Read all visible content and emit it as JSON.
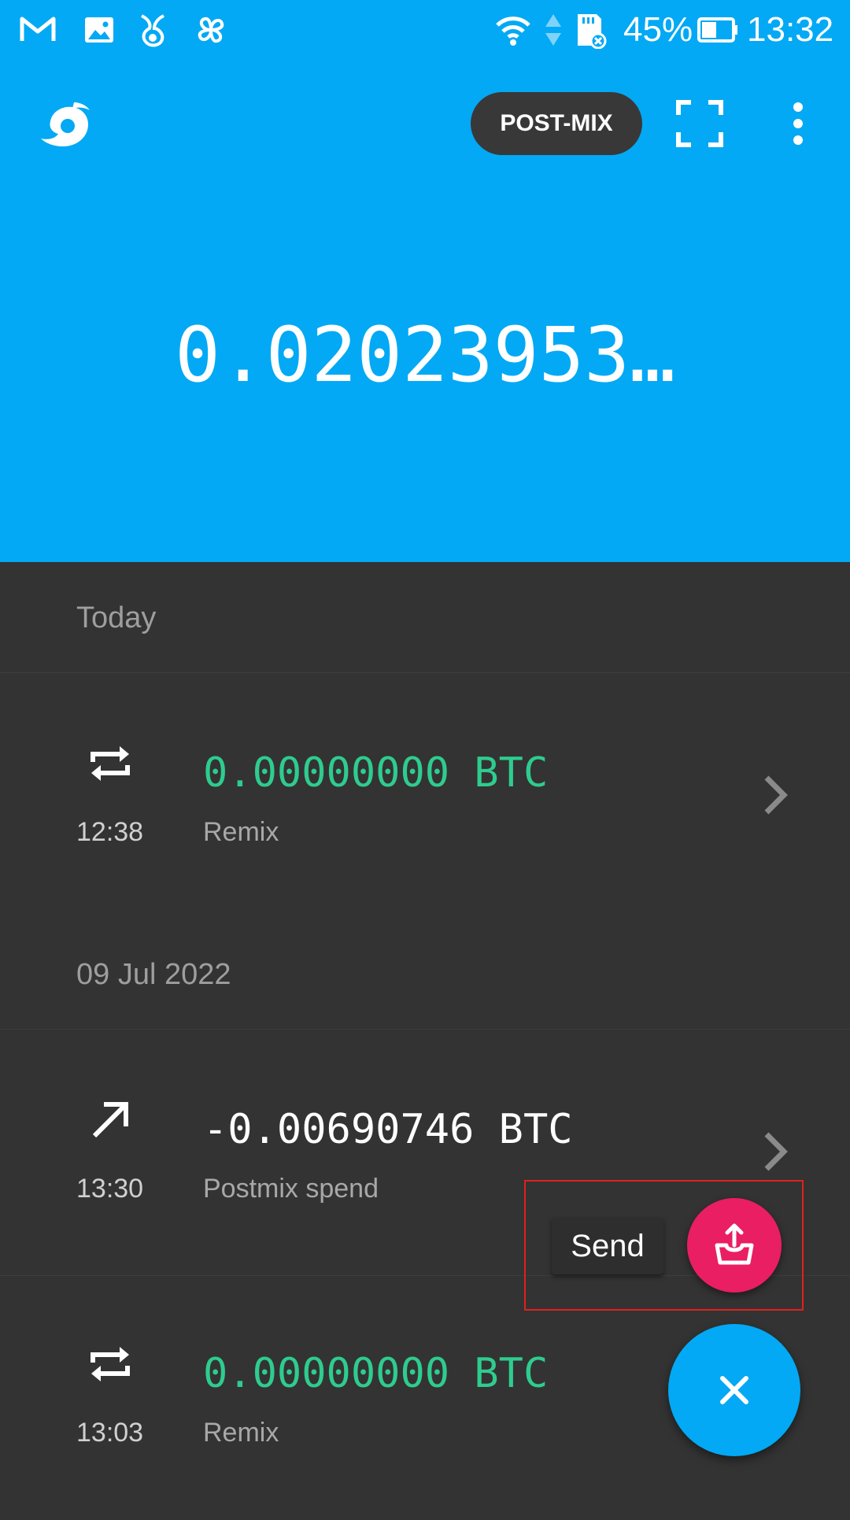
{
  "status_bar": {
    "battery_percent": "45%",
    "time": "13:32",
    "icons": [
      "gmail-icon",
      "gallery-icon",
      "tor-onion-icon",
      "fan-icon",
      "wifi-icon",
      "data-arrows-icon",
      "sd-card-error-icon",
      "battery-icon"
    ]
  },
  "toolbar": {
    "logo": "samourai-logo-icon",
    "postmix_label": "POST-MIX",
    "scan_icon": "qr-scan-icon",
    "menu_icon": "more-vert-icon"
  },
  "balance": {
    "value": "0.02023953…"
  },
  "colors": {
    "header_bg": "#03a9f4",
    "list_bg": "#333333",
    "positive_amount": "#2ecc8f",
    "send_fab": "#e91e63",
    "main_fab": "#03a9f4"
  },
  "sections": [
    {
      "header": "Today",
      "transactions": [
        {
          "icon": "swap-arrows-icon",
          "time": "12:38",
          "amount": "0.00000000 BTC",
          "label": "Remix"
        }
      ]
    },
    {
      "header": "09 Jul 2022",
      "transactions": [
        {
          "icon": "arrow-up-right-icon",
          "time": "13:30",
          "amount": "-0.00690746 BTC",
          "label": "Postmix spend"
        },
        {
          "icon": "swap-arrows-icon",
          "time": "13:03",
          "amount": "0.00000000 BTC",
          "label": "Remix"
        }
      ]
    }
  ],
  "fab_menu": {
    "send_label": "Send",
    "send_icon": "send-tray-icon",
    "close_icon": "close-icon"
  }
}
